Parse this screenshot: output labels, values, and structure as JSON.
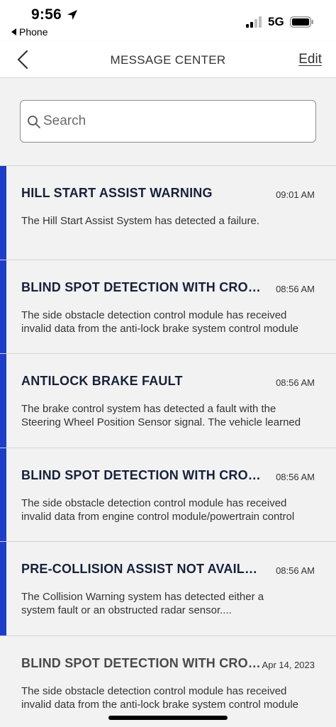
{
  "status_bar": {
    "time": "9:56",
    "back_app": "Phone",
    "network": "5G",
    "icons": [
      "location-arrow-icon",
      "signal-bars-icon",
      "battery-icon"
    ]
  },
  "nav": {
    "title": "MESSAGE CENTER",
    "edit_label": "Edit",
    "back_icon": "chevron-left-icon"
  },
  "search": {
    "placeholder": "Search",
    "value": "",
    "icon": "search-icon"
  },
  "colors": {
    "unread_accent": "#1d3ec8",
    "title_unread": "#17213a",
    "title_read": "#4a4a4a",
    "background": "#f2f2f2"
  },
  "messages": [
    {
      "title": "HILL START ASSIST WARNING",
      "time": "09:01 AM",
      "body_line1": "The Hill Start Assist System has detected a failure.",
      "body_line2": "",
      "unread": true
    },
    {
      "title": "BLIND SPOT DETECTION WITH CROSS TRAFFIC ALERT",
      "time": "08:56 AM",
      "body_line1": "The side obstacle detection control module has received",
      "body_line2": "invalid data from the anti-lock brake system control module",
      "unread": true
    },
    {
      "title": "ANTILOCK BRAKE FAULT",
      "time": "08:56 AM",
      "body_line1": "The brake control system has detected a fault with the",
      "body_line2": "Steering Wheel Position Sensor signal.  The vehicle learned",
      "unread": true
    },
    {
      "title": "BLIND SPOT DETECTION WITH CROSS TRAFFIC ALERT",
      "time": "08:56 AM",
      "body_line1": "The side obstacle detection control module  has received",
      "body_line2": "invalid data from engine control module/powertrain control",
      "unread": true
    },
    {
      "title": "PRE-COLLISION ASSIST NOT AVAILABLE",
      "time": "08:56 AM",
      "body_line1": "The Collision Warning system has detected either a",
      "body_line2": "system fault or an obstructed radar sensor....",
      "unread": true
    },
    {
      "title": "BLIND SPOT DETECTION WITH CROSS TRAFFIC ALERT",
      "time": "Apr 14, 2023",
      "body_line1": "The side obstacle detection control module has received",
      "body_line2": "invalid data from the anti-lock brake system control module",
      "unread": false
    }
  ]
}
